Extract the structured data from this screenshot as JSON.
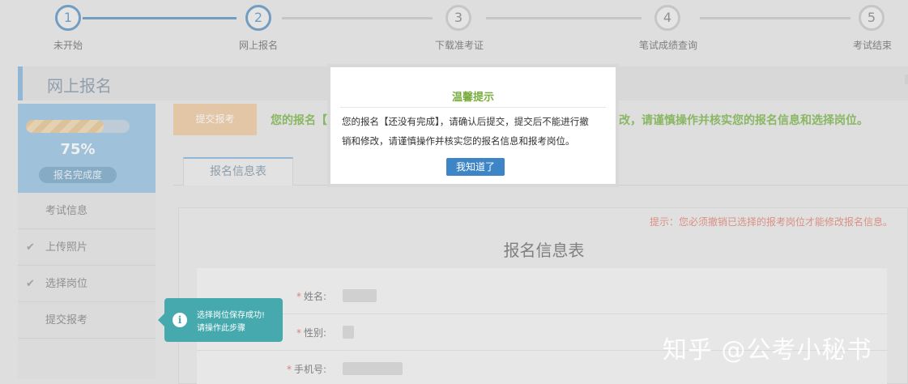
{
  "steps": [
    {
      "num": "1",
      "label": "未开始"
    },
    {
      "num": "2",
      "label": "网上报名"
    },
    {
      "num": "3",
      "label": "下载准考证"
    },
    {
      "num": "4",
      "label": "笔试成绩查询"
    },
    {
      "num": "5",
      "label": "考试结束"
    }
  ],
  "section": {
    "title": "网上报名"
  },
  "progress": {
    "value": 0.75,
    "percent_text": "75%",
    "caption": "报名完成度"
  },
  "sidebar": {
    "items": [
      {
        "label": "考试信息",
        "check": ""
      },
      {
        "label": "上传照片",
        "check": "✔"
      },
      {
        "label": "选择岗位",
        "check": "✔"
      },
      {
        "label": "提交报考",
        "check": ""
      }
    ]
  },
  "submit": {
    "button_label": "提交报考",
    "warning_visible_start": "您的报名【",
    "warning_visible_end": "改，请谨慎操作并核实您的报名信息和选择岗位。"
  },
  "tabs": [
    {
      "label": "报名信息表"
    }
  ],
  "form": {
    "hint": "提示：您必须撤销已选择的报考岗位才能修改报名信息。",
    "title": "报名信息表",
    "fields": [
      {
        "label": "姓名:"
      },
      {
        "label": "性别:"
      },
      {
        "label": "手机号:"
      }
    ]
  },
  "tooltip": {
    "line1": "选择岗位保存成功!",
    "line2": "请操作此步骤"
  },
  "modal": {
    "title": "温馨提示",
    "line1": "您的报名【还没有完成】，请确认后提交，提交后不能进行撤",
    "line2": "销和修改，请谨慎操作并核实您的报名信息和报考岗位。",
    "button": "我知道了"
  },
  "watermark": "知乎 @公考小秘书"
}
